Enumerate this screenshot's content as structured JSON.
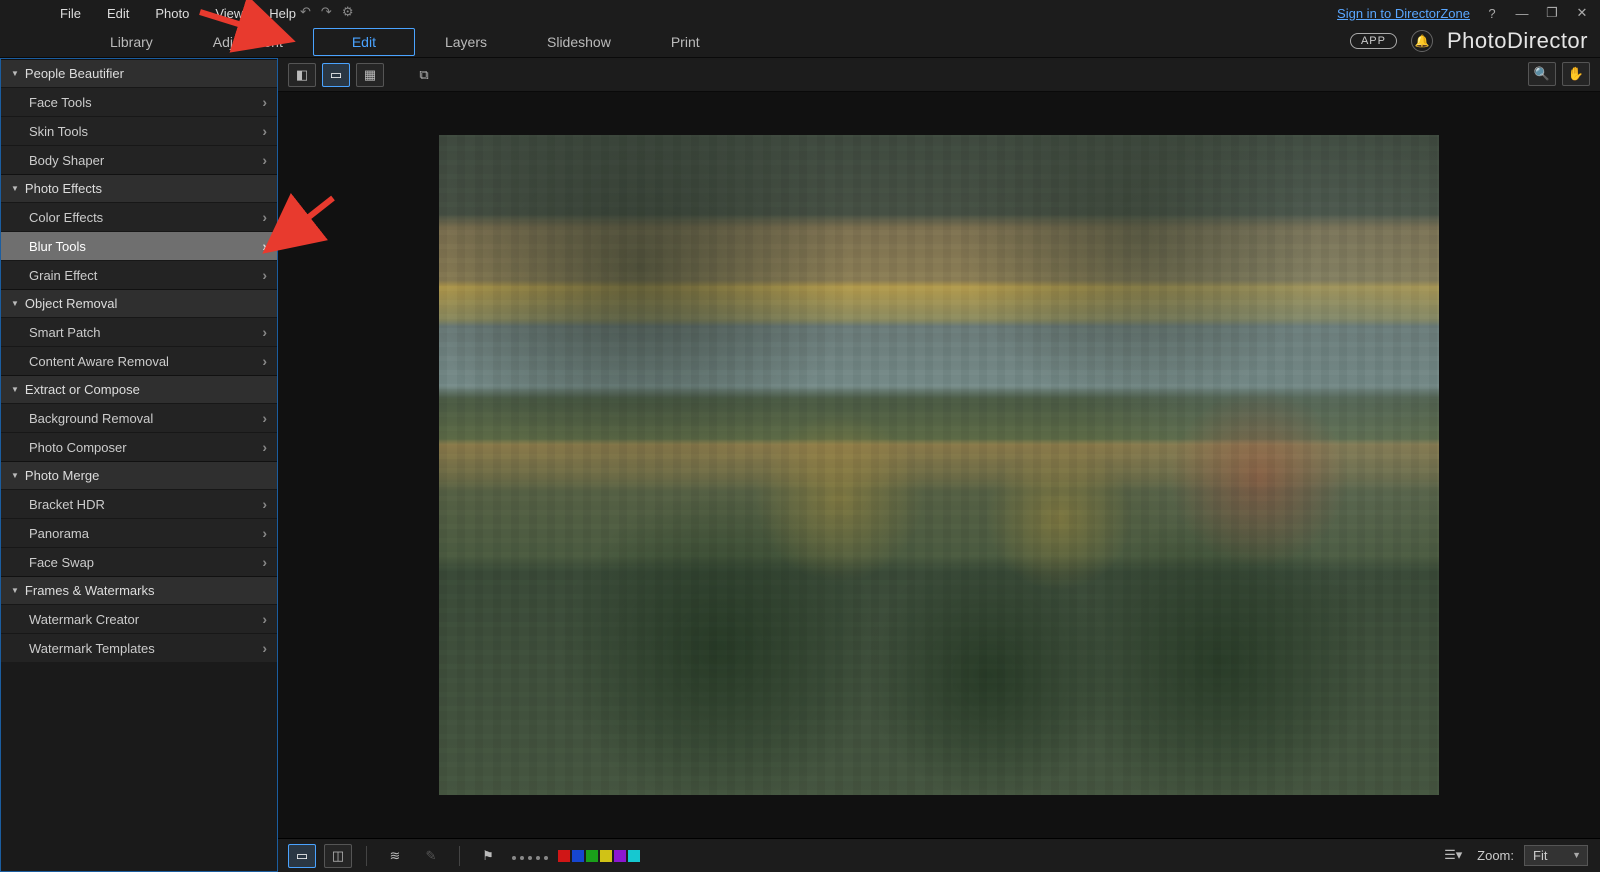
{
  "menubar": {
    "items": [
      "File",
      "Edit",
      "Photo",
      "View",
      "Help"
    ],
    "signin": "Sign in to DirectorZone"
  },
  "tabs": {
    "items": [
      "Library",
      "Adjustment",
      "Edit",
      "Layers",
      "Slideshow",
      "Print"
    ],
    "active_index": 2,
    "app_badge": "APP",
    "brand": "PhotoDirector"
  },
  "sidebar": {
    "groups": [
      {
        "title": "People Beautifier",
        "items": [
          {
            "label": "Face Tools",
            "chevron": true
          },
          {
            "label": "Skin Tools",
            "chevron": true
          },
          {
            "label": "Body Shaper",
            "chevron": true
          }
        ]
      },
      {
        "title": "Photo Effects",
        "items": [
          {
            "label": "Color Effects",
            "chevron": true
          },
          {
            "label": "Blur Tools",
            "chevron": true,
            "highlight": true
          },
          {
            "label": "Grain Effect",
            "chevron": true
          }
        ]
      },
      {
        "title": "Object Removal",
        "items": [
          {
            "label": "Smart Patch",
            "chevron": true
          },
          {
            "label": "Content Aware Removal",
            "chevron": true
          }
        ]
      },
      {
        "title": "Extract or Compose",
        "items": [
          {
            "label": "Background Removal",
            "chevron": true
          },
          {
            "label": "Photo Composer",
            "chevron": true
          }
        ]
      },
      {
        "title": "Photo Merge",
        "items": [
          {
            "label": "Bracket HDR",
            "chevron": true
          },
          {
            "label": "Panorama",
            "chevron": true
          },
          {
            "label": "Face Swap",
            "chevron": true
          }
        ]
      },
      {
        "title": "Frames & Watermarks",
        "items": [
          {
            "label": "Watermark Creator",
            "chevron": true
          },
          {
            "label": "Watermark Templates",
            "chevron": true
          }
        ]
      }
    ]
  },
  "bottombar": {
    "swatches": [
      "#d01616",
      "#1646d0",
      "#1aa01a",
      "#d0c216",
      "#8c16d0",
      "#16c8d0"
    ],
    "zoom_label": "Zoom:",
    "zoom_value": "Fit"
  }
}
